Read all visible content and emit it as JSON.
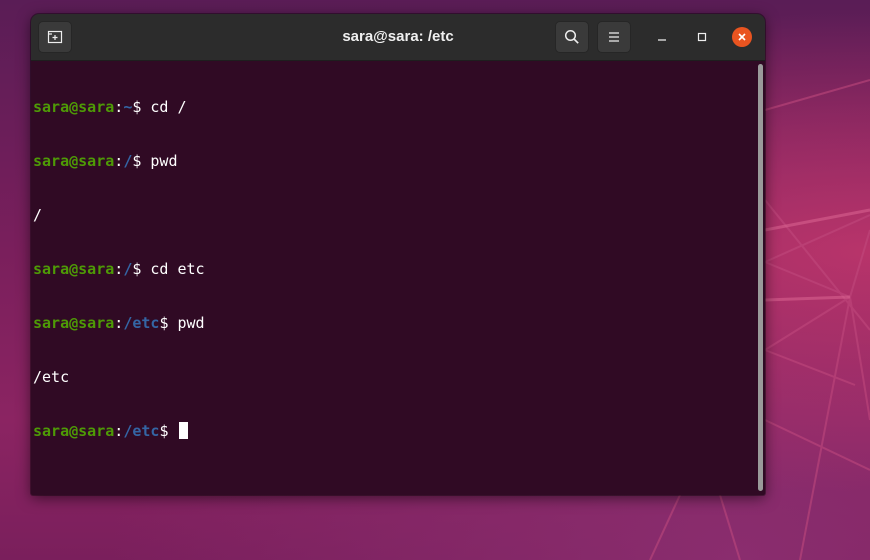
{
  "window": {
    "title": "sara@sara: /etc"
  },
  "headerbar": {
    "new_tab_icon": "new-tab-icon",
    "search_icon": "search-icon",
    "menu_icon": "hamburger-menu-icon",
    "minimize_icon": "minimize-icon",
    "maximize_icon": "maximize-icon",
    "close_icon": "close-icon"
  },
  "terminal": {
    "lines": [
      {
        "type": "prompt",
        "user": "sara@sara",
        "sep": ":",
        "path": "~",
        "prompt": "$ ",
        "cmd": "cd /"
      },
      {
        "type": "prompt",
        "user": "sara@sara",
        "sep": ":",
        "path": "/",
        "prompt": "$ ",
        "cmd": "pwd"
      },
      {
        "type": "output",
        "text": "/"
      },
      {
        "type": "prompt",
        "user": "sara@sara",
        "sep": ":",
        "path": "/",
        "prompt": "$ ",
        "cmd": "cd etc"
      },
      {
        "type": "prompt",
        "user": "sara@sara",
        "sep": ":",
        "path": "/etc",
        "prompt": "$ ",
        "cmd": "pwd"
      },
      {
        "type": "output",
        "text": "/etc"
      },
      {
        "type": "prompt",
        "user": "sara@sara",
        "sep": ":",
        "path": "/etc",
        "prompt": "$ ",
        "cmd": ""
      }
    ]
  },
  "colors": {
    "terminal_bg": "#300a24",
    "user_green": "#4e9a06",
    "path_blue": "#3465a4",
    "close_orange": "#e95420",
    "headerbar_bg": "#2c2c2c"
  }
}
